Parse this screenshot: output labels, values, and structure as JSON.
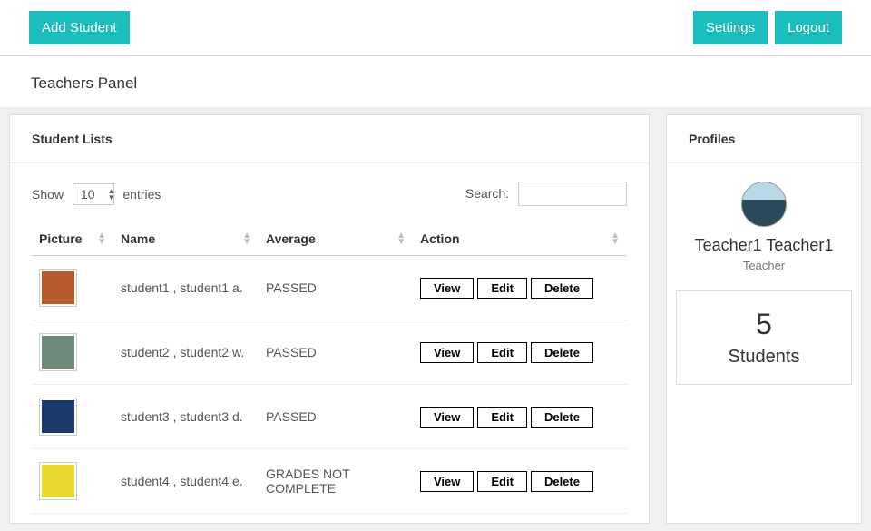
{
  "topbar": {
    "add_label": "Add Student",
    "settings_label": "Settings",
    "logout_label": "Logout"
  },
  "page_title": "Teachers Panel",
  "student_panel": {
    "header": "Student Lists",
    "show_label": "Show",
    "entries_value": "10",
    "entries_label": "entries",
    "search_label": "Search:",
    "columns": {
      "picture": "Picture",
      "name": "Name",
      "average": "Average",
      "action": "Action"
    },
    "action_labels": {
      "view": "View",
      "edit": "Edit",
      "delete": "Delete"
    },
    "rows": [
      {
        "thumb_color": "#b85c2e",
        "name": "student1 , student1 a.",
        "average": "PASSED"
      },
      {
        "thumb_color": "#6b8a7a",
        "name": "student2 , student2 w.",
        "average": "PASSED"
      },
      {
        "thumb_color": "#1a3a6a",
        "name": "student3 , student3 d.",
        "average": "PASSED"
      },
      {
        "thumb_color": "#e8d830",
        "name": "student4 , student4 e.",
        "average": "GRADES NOT COMPLETE"
      }
    ]
  },
  "profile_panel": {
    "header": "Profiles",
    "name": "Teacher1 Teacher1",
    "role": "Teacher",
    "stat_num": "5",
    "stat_label": "Students"
  }
}
